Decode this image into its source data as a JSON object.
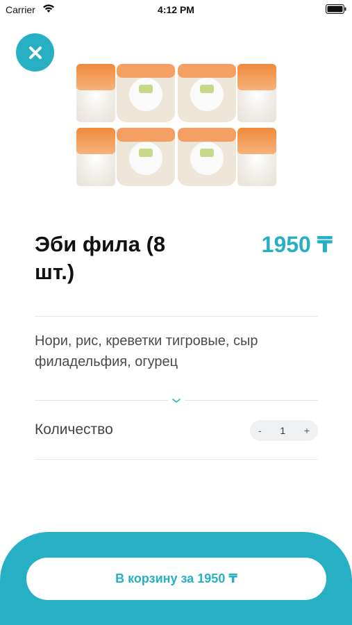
{
  "status_bar": {
    "carrier": "Carrier",
    "time": "4:12 PM",
    "wifi_icon": "wifi-icon",
    "battery_icon": "battery-icon"
  },
  "close_icon": "close-icon",
  "accent_color": "#27b0c4",
  "product": {
    "image_icon": "sushi-rolls-image",
    "title": "Эби фила (8 шт.)",
    "price": "1950 ₸",
    "description": "Нори, рис, креветки тигровые, сыр филадельфия, огурец"
  },
  "expand_icon": "chevron-down-icon",
  "quantity": {
    "label": "Количество",
    "minus": "-",
    "value": "1",
    "plus": "+"
  },
  "cart_button": {
    "label": "В корзину за 1950 ₸"
  }
}
